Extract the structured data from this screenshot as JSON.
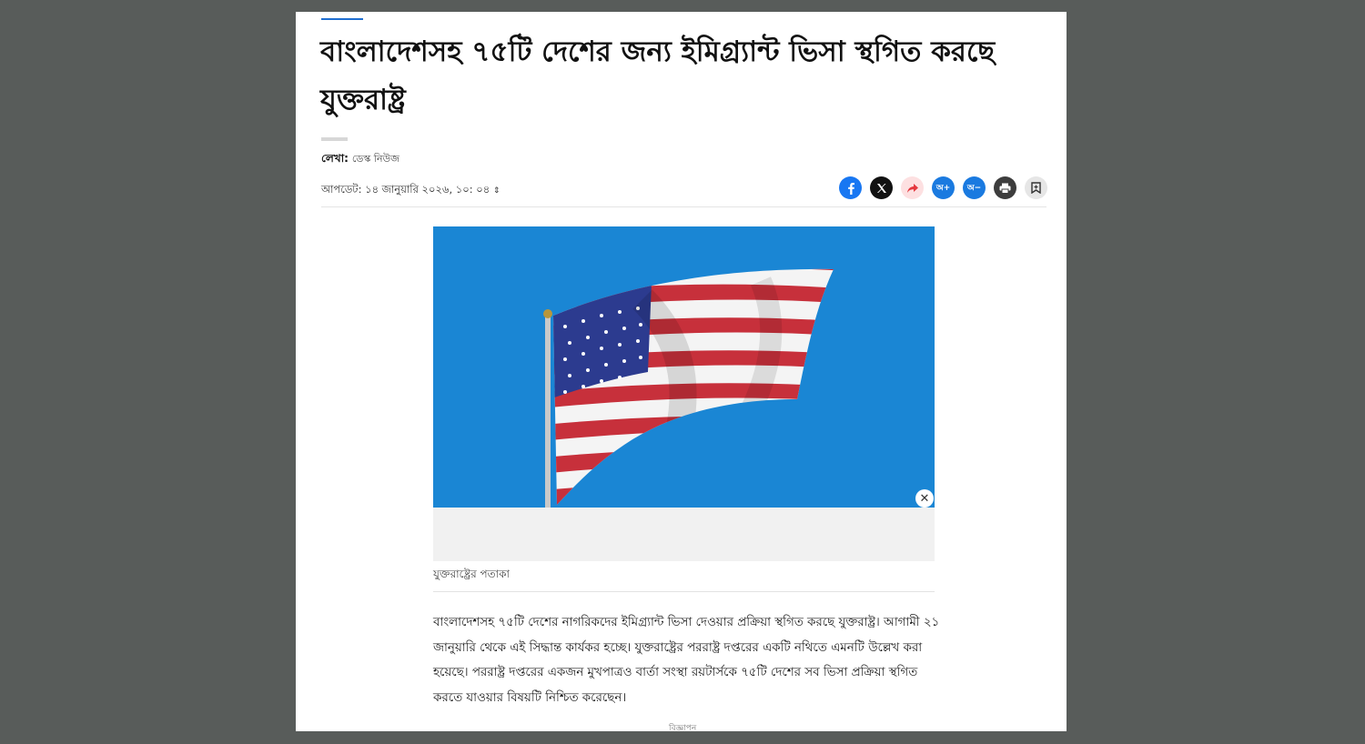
{
  "article": {
    "headline": "বাংলাদেশসহ ৭৫টি দেশের জন্য ইমিগ্র্যান্ট ভিসা স্থগিত করছে যুক্তরাষ্ট্র",
    "byline_label": "লেখা:",
    "byline_source": "ডেস্ক নিউজ",
    "updated": "আপডেট: ১৪ জানুয়ারি ২০২৬, ১০: ০৪",
    "image_caption": "যুক্তরাষ্ট্রের পতাকা",
    "body": "বাংলাদেশসহ ৭৫টি দেশের নাগরিকদের ইমিগ্র্যান্ট ভিসা দেওয়ার প্রক্রিয়া স্থগিত করছে যুক্তরাষ্ট্র। আগামী ২১ জানুয়ারি থেকে এই সিদ্ধান্ত কার্যকর হচ্ছে। যুক্তরাষ্ট্রের পররাষ্ট্র দপ্তরের একটি নথিতে এমনটি উল্লেখ করা হয়েছে। পররাষ্ট্র দপ্তরের একজন মুখপাত্রও বার্তা সংস্থা রয়টার্সকে ৭৫টি দেশের সব ভিসা প্রক্রিয়া স্থগিত করতে যাওয়ার বিষয়টি নিশ্চিত করেছেন।",
    "ad_label": "বিজ্ঞাপন"
  },
  "share": {
    "font_increase": "অ+",
    "font_decrease": "অ−",
    "icons": [
      "facebook-icon",
      "x-icon",
      "share-icon",
      "font-increase-icon",
      "font-decrease-icon",
      "print-icon",
      "bookmark-icon"
    ]
  },
  "colors": {
    "accent": "#1f6fd1",
    "facebook": "#1877f2",
    "sky": "#1a86d4",
    "flag_red": "#c7303b",
    "flag_blue": "#2c3b8f"
  }
}
